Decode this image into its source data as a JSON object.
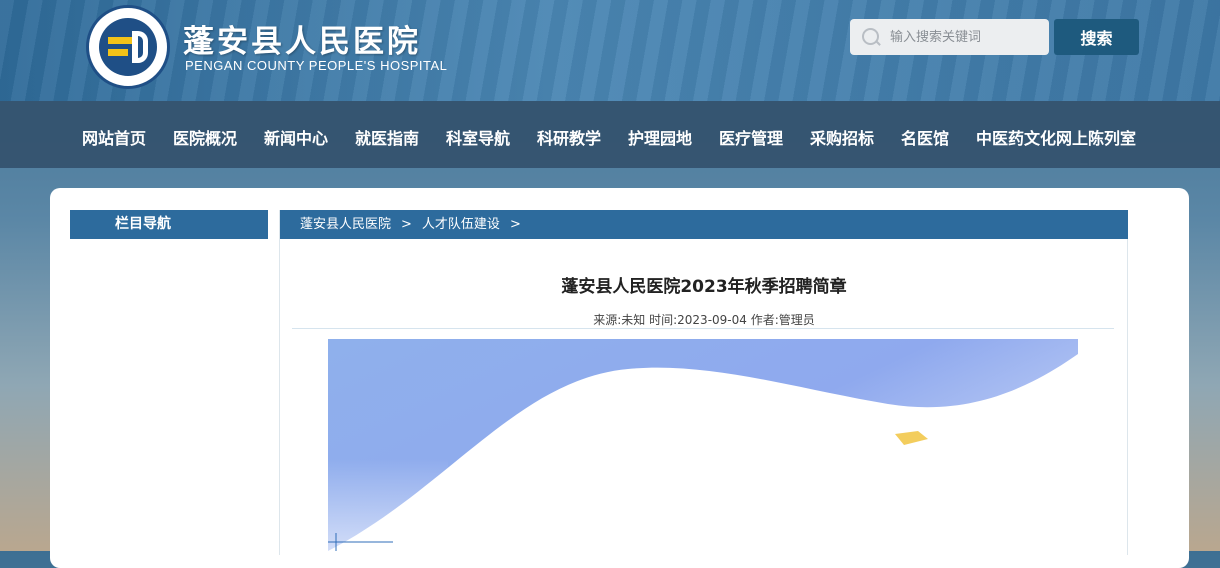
{
  "header": {
    "logo_cn": "蓬安县人民医院",
    "logo_en": "PENGAN COUNTY PEOPLE'S HOSPITAL",
    "search_placeholder": "输入搜索关键词",
    "search_button": "搜索"
  },
  "nav": [
    "网站首页",
    "医院概况",
    "新闻中心",
    "就医指南",
    "科室导航",
    "科研教学",
    "护理园地",
    "医疗管理",
    "采购招标",
    "名医馆",
    "中医药文化网上陈列室"
  ],
  "sidebar": {
    "title": "栏目导航"
  },
  "breadcrumb": {
    "home": "蓬安县人民医院",
    "sep": ">",
    "section": "人才队伍建设"
  },
  "article": {
    "title": "蓬安县人民医院2023年秋季招聘简章",
    "meta": "来源:未知 时间:2023-09-04 作者:管理员"
  },
  "colors": {
    "nav_bar": "#34526e",
    "accent_blue": "#2d6b9d",
    "search_button": "#1e5a7e"
  }
}
